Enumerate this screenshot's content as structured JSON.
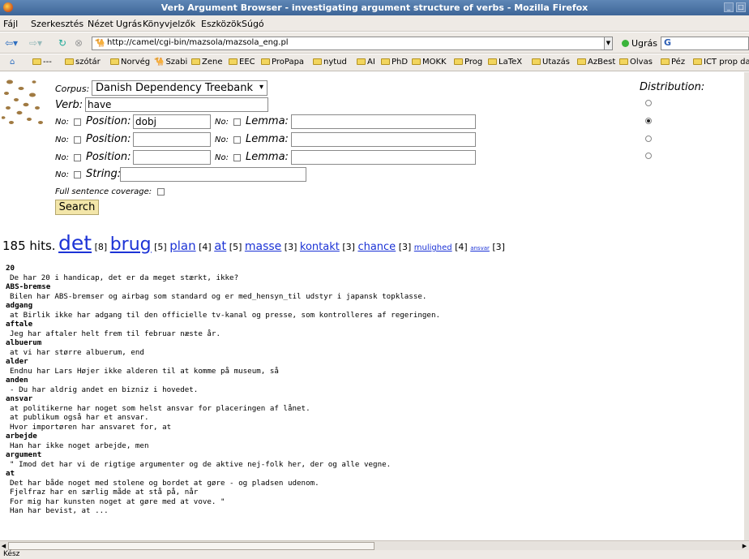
{
  "window": {
    "title": "Verb Argument Browser - investigating argument structure of verbs - Mozilla Firefox"
  },
  "menu": [
    "Fájl",
    "Szerkesztés",
    "Nézet",
    "Ugrás",
    "Könyvjelzők",
    "Eszközök",
    "Súgó"
  ],
  "nav": {
    "url": "http://camel/cgi-bin/mazsola/mazsola_eng.pl",
    "go_label": "Ugrás",
    "search_value": "G"
  },
  "bookmarks": [
    "---",
    "szótár",
    "Norvég",
    "Szabi",
    "Zene",
    "EEC",
    "ProPapa",
    "nytud",
    "AI",
    "PhD",
    "MOKK",
    "Prog",
    "LaTeX",
    "Utazás",
    "AzBest",
    "Olvas",
    "Péz",
    "ICT prop day"
  ],
  "form": {
    "corpus_label": "Corpus:",
    "corpus_value": "Danish Dependency Treebank",
    "verb_label": "Verb:",
    "verb_value": "have",
    "no_label": "No:",
    "position_label": "Position:",
    "lemma_label": "Lemma:",
    "string_label": "String:",
    "rows": [
      {
        "position": "dobj",
        "lemma": ""
      },
      {
        "position": "",
        "lemma": ""
      },
      {
        "position": "",
        "lemma": ""
      }
    ],
    "full_coverage_label": "Full sentence coverage:",
    "search_label": "Search",
    "distribution_label": "Distribution:"
  },
  "hits": {
    "count_text": "185 hits.",
    "items": [
      {
        "word": "det",
        "count": "[8]"
      },
      {
        "word": "brug",
        "count": "[5]"
      },
      {
        "word": "plan",
        "count": "[4]"
      },
      {
        "word": "at",
        "count": "[5]"
      },
      {
        "word": "masse",
        "count": "[3]"
      },
      {
        "word": "kontakt",
        "count": "[3]"
      },
      {
        "word": "chance",
        "count": "[3]"
      },
      {
        "word": "mulighed",
        "count": "[4]"
      },
      {
        "word": "ansvar",
        "count": "[3]"
      }
    ]
  },
  "results": [
    {
      "word": "20",
      "sentences": [
        "De har 20 i handicap, det er da meget stærkt, ikke?"
      ]
    },
    {
      "word": "ABS-bremse",
      "sentences": [
        "Bilen har ABS-bremser og airbag som standard og er med_hensyn_til udstyr i japansk topklasse."
      ]
    },
    {
      "word": "adgang",
      "sentences": [
        "at Birlik ikke har adgang til den officielle tv-kanal og presse, som kontrolleres af regeringen."
      ]
    },
    {
      "word": "aftale",
      "sentences": [
        "Jeg har aftaler helt frem til februar næste år."
      ]
    },
    {
      "word": "albuerum",
      "sentences": [
        "at vi har større albuerum, end"
      ]
    },
    {
      "word": "alder",
      "sentences": [
        "Endnu har Lars Højer ikke alderen til at komme på museum, så"
      ]
    },
    {
      "word": "anden",
      "sentences": [
        "- Du har aldrig andet en bizniz i hovedet."
      ]
    },
    {
      "word": "ansvar",
      "sentences": [
        "at politikerne har noget som helst ansvar for placeringen af lånet.",
        "at publikum også har et ansvar.",
        "Hvor importøren har ansvaret for, at"
      ]
    },
    {
      "word": "arbejde",
      "sentences": [
        "Han har ikke noget arbejde, men"
      ]
    },
    {
      "word": "argument",
      "sentences": [
        "\" Imod det har vi de rigtige argumenter og de aktive nej-folk her, der og alle vegne."
      ]
    },
    {
      "word": "at",
      "sentences": [
        "Det har både noget med stolene og bordet at gøre - og pladsen udenom.",
        "Fjelfraz har en særlig måde at stå på, når",
        "For mig har kunsten noget at gøre med at vove. \"",
        "Han har bevist, at ..."
      ]
    }
  ],
  "status": "Kész"
}
